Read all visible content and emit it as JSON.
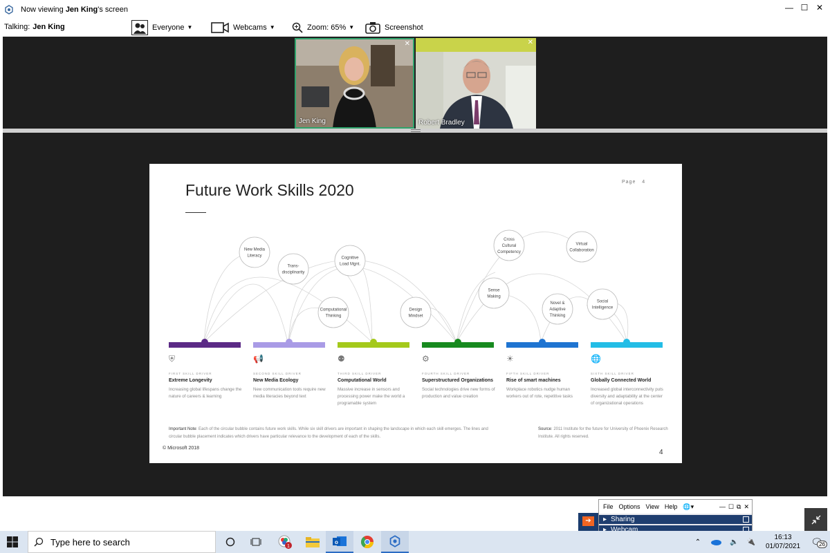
{
  "window": {
    "prefix": "Now viewing ",
    "presenter": "Jen King",
    "suffix": "'s screen"
  },
  "toolbar": {
    "talking_label": "Talking:",
    "talking_name": "Jen King",
    "audience_label": "Everyone",
    "webcams_label": "Webcams",
    "zoom_label": "Zoom: 65%",
    "screenshot_label": "Screenshot"
  },
  "webcams": [
    {
      "name": "Jen King",
      "active": true
    },
    {
      "name": "Robert Bradley",
      "active": false
    }
  ],
  "slide": {
    "title": "Future Work Skills 2020",
    "page_label": "Page",
    "page_value": "4",
    "page_number": "4",
    "copyright": "© Microsoft 2018",
    "note_label": "Important Note",
    "note_text": ": Each of the circular bubble contains future work skills. While six skill drivers are important in shaping the landscape in which each skill emerges. The lines and circular bubble placement indicates which drivers have particular relevance to the development of each of the skills.",
    "source_label": "Source",
    "source_text": ": 2011 Institute for the future for University of Phoenix Research Institute. All rights reserved.",
    "skills": [
      {
        "line1": "New Media",
        "line2": "Literacy",
        "line3": ""
      },
      {
        "line1": "Trans-",
        "line2": "disciplinarity",
        "line3": ""
      },
      {
        "line1": "Cognitive",
        "line2": "Load  Mgnt.",
        "line3": ""
      },
      {
        "line1": "Computational",
        "line2": "Thinking",
        "line3": ""
      },
      {
        "line1": "Design",
        "line2": "Mindset",
        "line3": ""
      },
      {
        "line1": "Cross",
        "line2": "Cultural",
        "line3": "Competency"
      },
      {
        "line1": "Virtual",
        "line2": "Collaboration",
        "line3": ""
      },
      {
        "line1": "Sense",
        "line2": "Making",
        "line3": ""
      },
      {
        "line1": "Novel &",
        "line2": "Adaptive",
        "line3": "Thinking"
      },
      {
        "line1": "Social",
        "line2": "Intelligence",
        "line3": ""
      }
    ],
    "drivers": [
      {
        "ordinal": "FIRST SKILL DRIVER",
        "title": "Extreme Longevity",
        "desc": "Increasing global lifespans change the nature of careers & learning",
        "color": "#5b2a86",
        "icon": "shield-icon"
      },
      {
        "ordinal": "SECOND SKILL DRIVER",
        "title": "New Media Ecology",
        "desc": "New communication tools require new media literacies beyond text",
        "color": "#a99be6",
        "icon": "megaphone-icon"
      },
      {
        "ordinal": "THIRD SKILL DRIVER",
        "title": "Computational World",
        "desc": "Massive increase in sensors and processing power make the world a programable system",
        "color": "#a4c91b",
        "icon": "head-icon"
      },
      {
        "ordinal": "FOURTH SKILL DRIVER",
        "title": "Superstructured Organizations",
        "desc": "Social technologies drive new forms of production and value creation",
        "color": "#178a1f",
        "icon": "gears-icon"
      },
      {
        "ordinal": "FIFTH SKILL DRIVER",
        "title": "Rise of smart machines",
        "desc": "Workplace robotics nudge human workers out of rote, repetitive tasks",
        "color": "#1f74d1",
        "icon": "lightbulb-icon"
      },
      {
        "ordinal": "SIXTH SKILL DRIVER",
        "title": "Globally Connected World",
        "desc": "Increased global interconnectivity puts diversity and adaptability at the center of organizational operations",
        "color": "#23bde6",
        "icon": "globe-icon"
      }
    ]
  },
  "control_panel": {
    "menu": [
      "File",
      "Options",
      "View",
      "Help"
    ],
    "rows": [
      "Sharing",
      "Webcam"
    ]
  },
  "taskbar": {
    "search_placeholder": "Type here to search",
    "time": "16:13",
    "date": "01/07/2021",
    "notification_count": "26",
    "teams_badge": "1"
  }
}
